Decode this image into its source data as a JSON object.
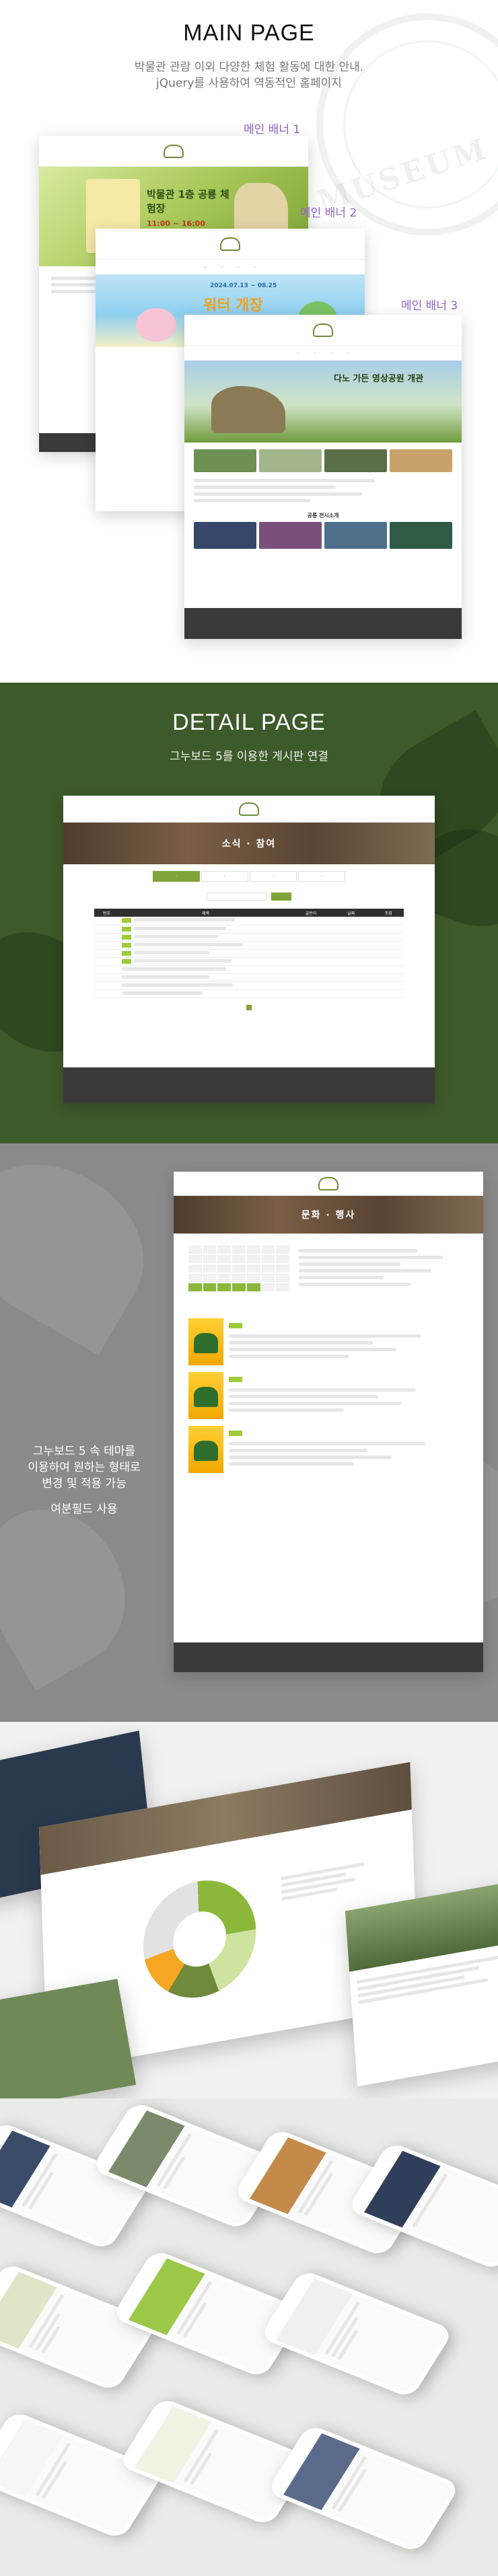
{
  "main": {
    "title": "MAIN PAGE",
    "subtitle_line1": "박물관 관람 이외 다양한 체험 활동에 대한 안내.",
    "subtitle_line2": "jQuery를 사용하여 역동적인 홈페이지",
    "banner_labels": [
      "메인 배너 1",
      "메인 배너 2",
      "메인 배너 3"
    ],
    "banner1_text": "박물관 1층 공룡 체험장",
    "banner1_time": "11:00 ~ 16:00",
    "banner2_date": "2024.07.13 ~ 08.25",
    "banner2_text": "워터 개장",
    "banner3_text": "다노 가든 영상공원 개관",
    "section_label": "공룡 전시소개"
  },
  "detail": {
    "title": "DETAIL PAGE",
    "subtitle": "그누보드 5를 이용한 게시판 연결",
    "hero_title": "소식 · 참여",
    "table_headers": [
      "번호",
      "제목",
      "글쓴이",
      "날짜",
      "조회"
    ]
  },
  "calendar": {
    "hero_title": "문화 · 행사",
    "caption_line1": "그누보드 5 속 테마를",
    "caption_line2": "이용하여 원하는 형태로",
    "caption_line3": "변경 및 적용 가능",
    "caption_line4": "여분필드 사용"
  },
  "colors": {
    "accent_green": "#7ea336",
    "detail_bg": "#3d5a2a",
    "gray_bg": "#8a8a8a",
    "label_purple": "#8a64c8"
  }
}
